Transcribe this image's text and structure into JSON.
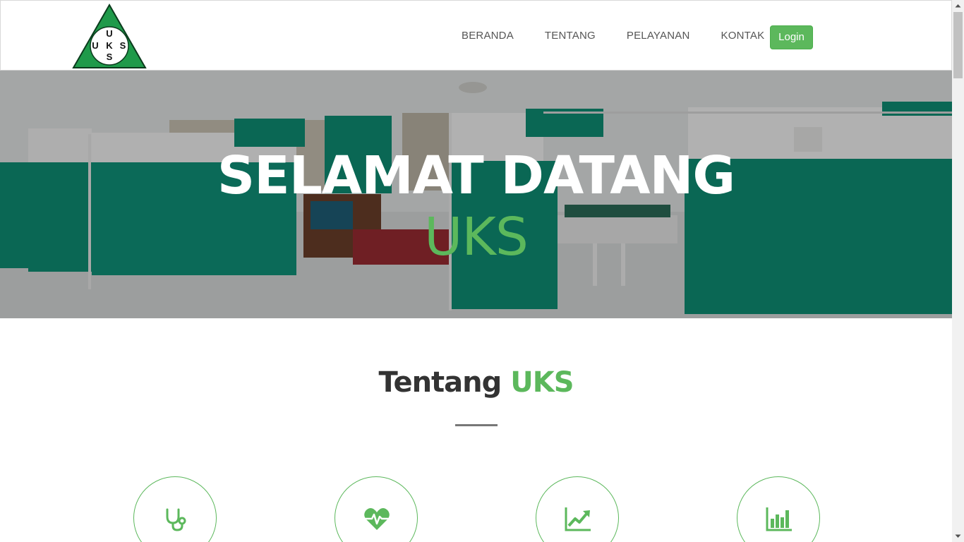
{
  "brand": {
    "logo_letters": [
      "U",
      "K",
      "S",
      "U",
      "K",
      "S"
    ],
    "logo_green": "#1f9a4a"
  },
  "nav": {
    "items": [
      {
        "label": "BERANDA"
      },
      {
        "label": "TENTANG"
      },
      {
        "label": "PELAYANAN"
      },
      {
        "label": "KONTAK"
      }
    ],
    "login_label": "Login"
  },
  "hero": {
    "title": "SELAMAT DATANG",
    "subtitle": "UKS"
  },
  "about": {
    "title_main": "Tentang",
    "title_accent": "UKS"
  },
  "features": [
    {
      "icon": "stethoscope-icon"
    },
    {
      "icon": "heartbeat-icon"
    },
    {
      "icon": "line-chart-icon"
    },
    {
      "icon": "bar-chart-icon"
    }
  ],
  "colors": {
    "accent": "#5cb85c",
    "text_dark": "#333333",
    "nav_text": "#555555",
    "curtain": "#0f8f75"
  }
}
